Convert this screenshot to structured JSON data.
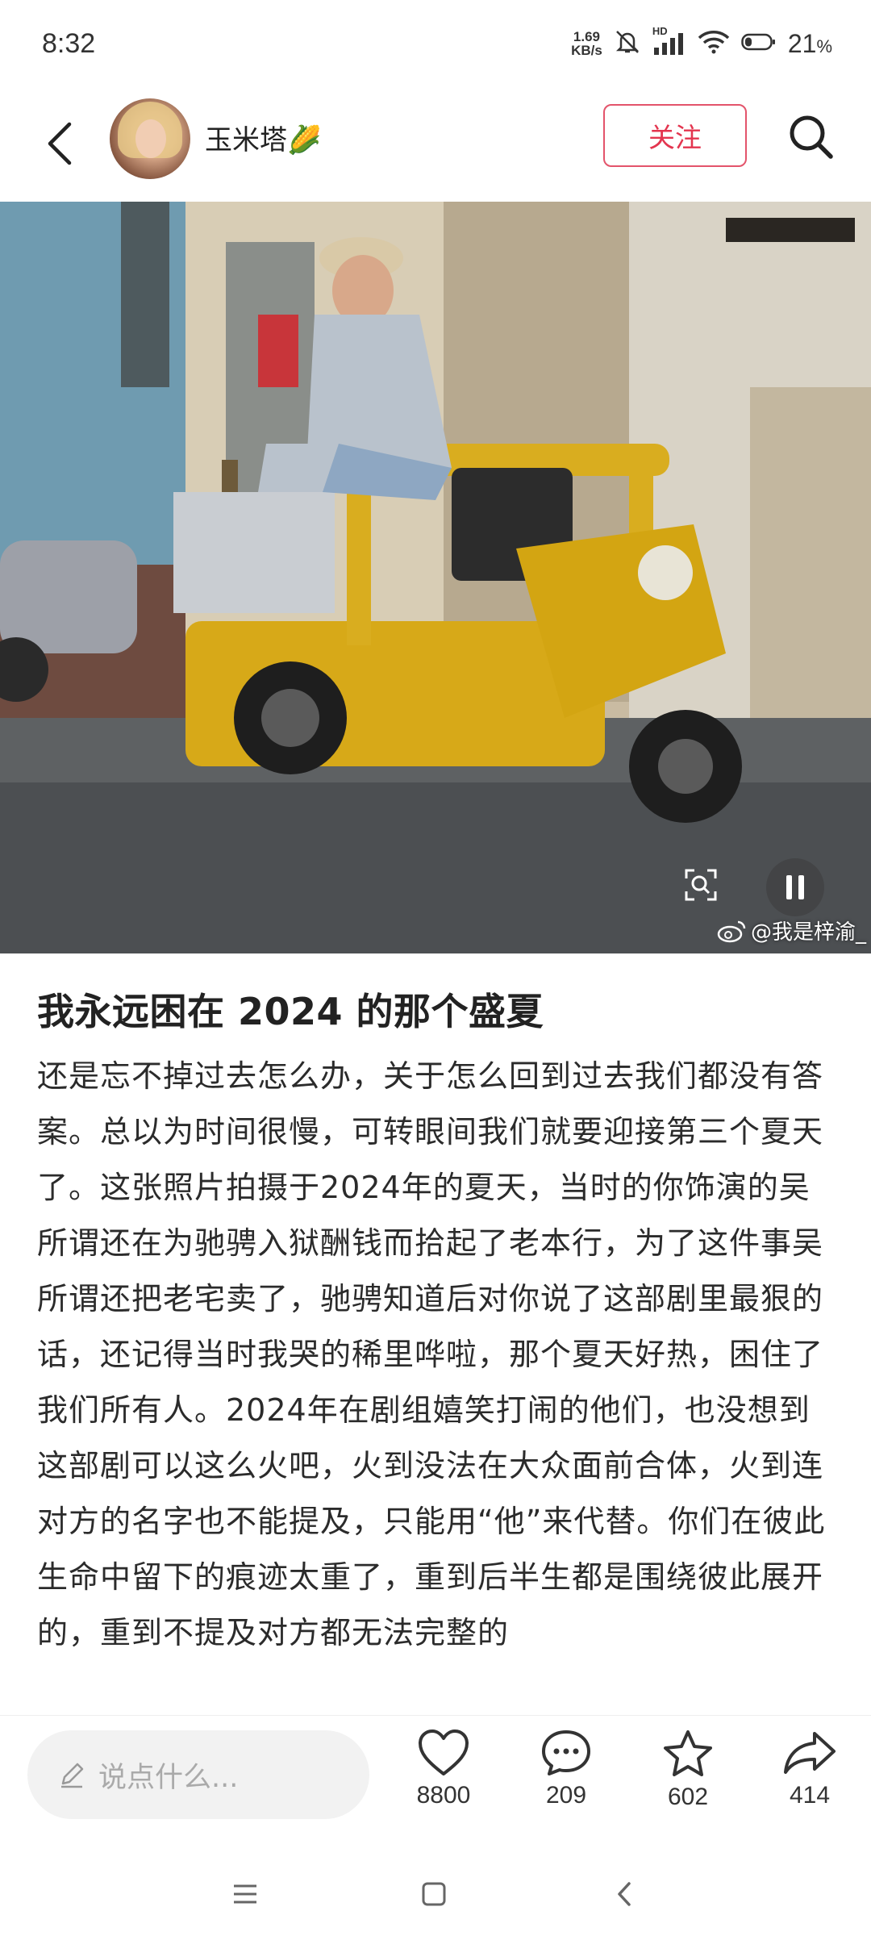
{
  "status_bar": {
    "time": "8:32",
    "net_speed_value": "1.69",
    "net_speed_unit": "KB/s",
    "signal_label": "HD",
    "battery_percent": "21",
    "battery_unit": "%"
  },
  "header": {
    "author_name": "玉米塔🌽",
    "follow_label": "关注"
  },
  "photo": {
    "watermark": "@我是梓渝_"
  },
  "article": {
    "title": "我永远困在 2024 的那个盛夏",
    "body": "还是忘不掉过去怎么办，关于怎么回到过去我们都没有答案。总以为时间很慢，可转眼间我们就要迎接第三个夏天了。这张照片拍摄于2024年的夏天，当时的你饰演的吴所谓还在为驰骋入狱酬钱而拾起了老本行，为了这件事吴所谓还把老宅卖了，驰骋知道后对你说了这部剧里最狠的话，还记得当时我哭的稀里哗啦，那个夏天好热，困住了我们所有人。2024年在剧组嬉笑打闹的他们，也没想到这部剧可以这么火吧，火到没法在大众面前合体，火到连对方的名字也不能提及，只能用“他”来代替。你们在彼此生命中留下的痕迹太重了，重到后半生都是围绕彼此展开的，重到不提及对方都无法完整的"
  },
  "bottom_bar": {
    "comment_placeholder": "说点什么...",
    "like_count": "8800",
    "comment_count": "209",
    "favorite_count": "602",
    "share_count": "414"
  },
  "icons": {
    "back": "back-arrow-icon",
    "search": "search-icon",
    "like": "heart-icon",
    "comment": "comment-bubble-icon",
    "favorite": "star-icon",
    "share": "share-arrow-icon"
  },
  "colors": {
    "follow_accent": "#e3354f",
    "input_bg": "#f2f2f2"
  }
}
